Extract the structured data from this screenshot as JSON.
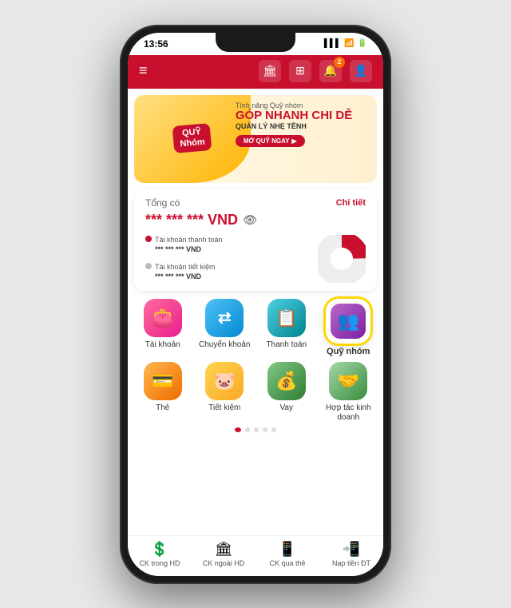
{
  "statusBar": {
    "time": "13:56",
    "signal": "▌▌▌",
    "wifi": "WiFi",
    "battery": "🔋"
  },
  "header": {
    "menuIcon": "≡",
    "icons": [
      "🏛",
      "📊",
      "🔔",
      "👤"
    ],
    "notificationCount": "2"
  },
  "banner": {
    "tagline": "Tính năng Quỹ nhóm",
    "title": "GÓP NHANH CHI DỄ",
    "subtitle": "QUẢN LÝ NHẸ TỀNH",
    "buttonLabel": "MỞ QUỸ NGAY",
    "badgeLine1": "QUỸ",
    "badgeLine2": "Nhóm"
  },
  "balance": {
    "title": "Tổng có",
    "detailLabel": "Chi tiết",
    "amount": "*** *** *** VND",
    "accounts": [
      {
        "label": "Tài khoản thanh toán",
        "value": "*** *** *** VND"
      },
      {
        "label": "Tài khoản tiết kiệm",
        "value": "*** *** *** VND"
      }
    ]
  },
  "menuItems": {
    "row1": [
      {
        "label": "Tài khoản",
        "icon": "👛",
        "bg": "pink"
      },
      {
        "label": "Chuyển khoản",
        "icon": "⇄",
        "bg": "blue"
      },
      {
        "label": "Thanh toán",
        "icon": "📋",
        "bg": "teal"
      },
      {
        "label": "Quỹ nhóm",
        "icon": "👥",
        "bg": "purple",
        "highlighted": true
      }
    ],
    "row2": [
      {
        "label": "Thẻ",
        "icon": "💳",
        "bg": "orange"
      },
      {
        "label": "Tiết kiệm",
        "icon": "🐷",
        "bg": "yellow"
      },
      {
        "label": "Vay",
        "icon": "💰",
        "bg": "green"
      },
      {
        "label": "Hợp tác kinh doanh",
        "icon": "🤝",
        "bg": "light-green"
      }
    ]
  },
  "pagination": {
    "dots": 5,
    "active": 0
  },
  "bottomNav": [
    {
      "label": "CK trong HD",
      "icon": "💲"
    },
    {
      "label": "CK ngoài HD",
      "icon": "🏛"
    },
    {
      "label": "CK qua thẻ",
      "icon": "📱"
    },
    {
      "label": "Nạp tiền ĐT",
      "icon": "📲"
    }
  ]
}
